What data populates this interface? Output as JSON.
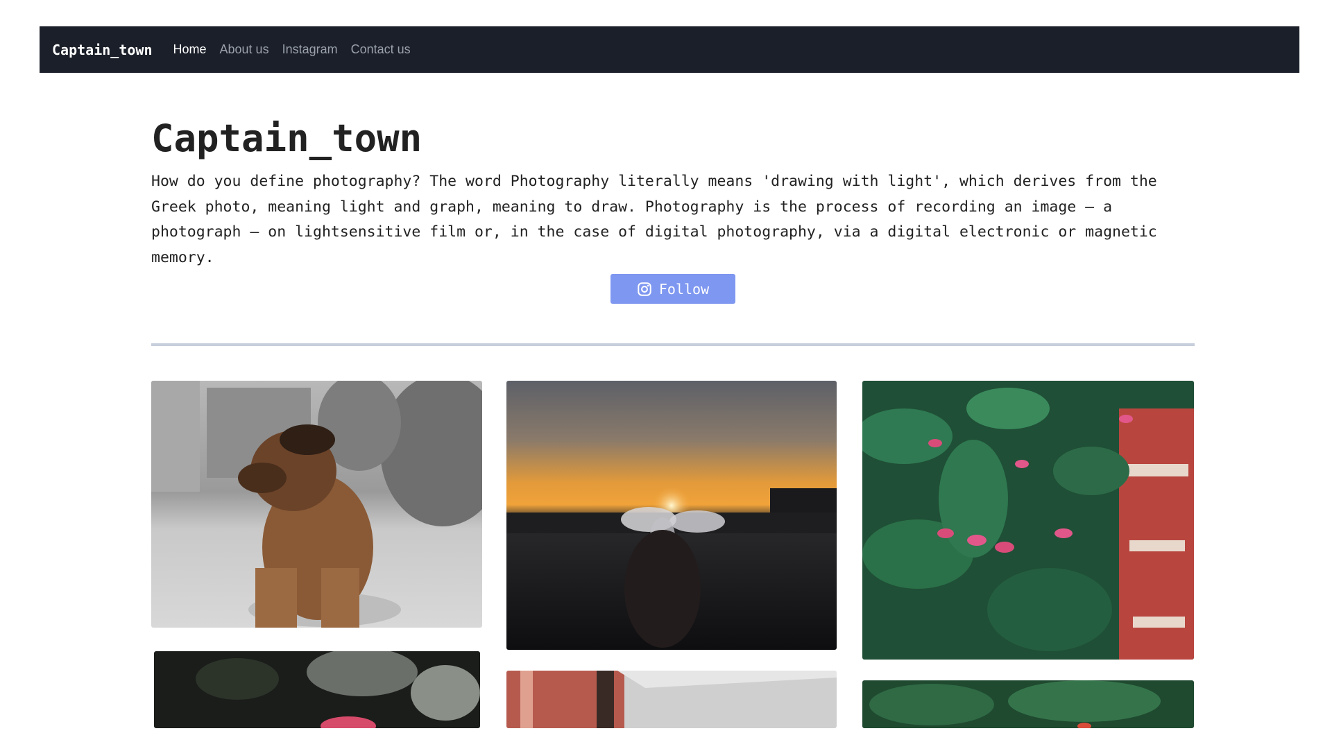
{
  "navbar": {
    "brand": "Captain_town",
    "links": [
      "Home",
      "About us",
      "Instagram",
      "Contact us"
    ],
    "active": "Home"
  },
  "hero": {
    "title": "Captain_town",
    "description": "How do you define photography? The word Photography literally means 'drawing with light', which derives from the Greek photo, meaning light and graph, meaning to draw. Photography is the process of recording an image – a photograph – on lightsensitive film or, in the case of digital photography, via a digital electronic or magnetic memory.",
    "follow_label": "Follow",
    "follow_icon": "instagram-icon"
  },
  "colors": {
    "navbar_bg": "#1b1f29",
    "button_bg": "#7e97f0",
    "divider": "#c7cfdc"
  },
  "gallery": {
    "photos": [
      "puppy-photo",
      "sunset-flower-photo",
      "pink-flowers-photo",
      "dark-flower-photo",
      "building-photo",
      "leaves-photo"
    ]
  }
}
